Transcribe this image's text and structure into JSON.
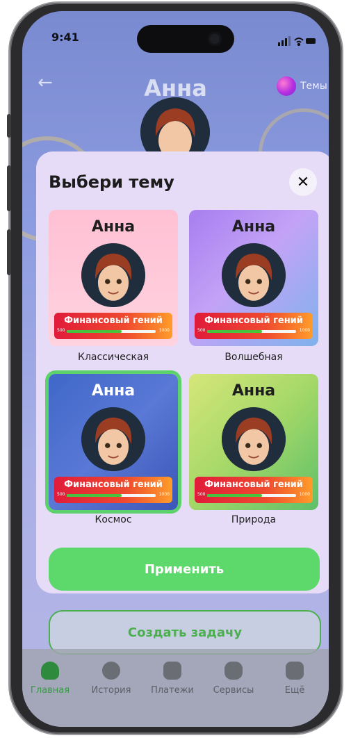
{
  "status": {
    "time": "9:41"
  },
  "header": {
    "title": "Анна",
    "themes_label": "Темы"
  },
  "modal": {
    "title": "Выбери тему",
    "themes": [
      {
        "label": "Классическая",
        "name": "Анна",
        "badge": "Финансовый гений",
        "min": "500",
        "max": "1000",
        "progress": 0.62
      },
      {
        "label": "Волшебная",
        "name": "Анна",
        "badge": "Финансовый гений",
        "min": "500",
        "max": "1000",
        "progress": 0.62
      },
      {
        "label": "Космос",
        "name": "Анна",
        "badge": "Финансовый гений",
        "min": "500",
        "max": "1000",
        "progress": 0.62,
        "selected": true
      },
      {
        "label": "Природа",
        "name": "Анна",
        "badge": "Финансовый гений",
        "min": "500",
        "max": "1000",
        "progress": 0.62
      }
    ],
    "apply_label": "Применить"
  },
  "create_task_label": "Создать задачу",
  "tabbar": {
    "items": [
      {
        "label": "Главная",
        "active": true
      },
      {
        "label": "История"
      },
      {
        "label": "Платежи"
      },
      {
        "label": "Сервисы"
      },
      {
        "label": "Ещё"
      }
    ]
  },
  "colors": {
    "accent_green": "#5dd86a",
    "badge_gradient_start": "#e01b3a",
    "badge_gradient_end": "#ff9c2a",
    "modal_bg": "#e6dcf8"
  }
}
